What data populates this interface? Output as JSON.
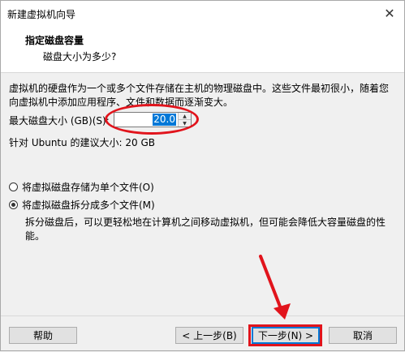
{
  "window": {
    "title": "新建虚拟机向导"
  },
  "header": {
    "title": "指定磁盘容量",
    "subtitle": "磁盘大小为多少?"
  },
  "main": {
    "description": "虚拟机的硬盘作为一个或多个文件存储在主机的物理磁盘中。这些文件最初很小，随着您向虚拟机中添加应用程序、文件和数据而逐渐变大。",
    "max_size_label": "最大磁盘大小 (GB)(S):",
    "max_size_value": "20.0",
    "recommend_text": "针对 Ubuntu 的建议大小: 20 GB",
    "options": [
      {
        "label": "将虚拟磁盘存储为单个文件(O)",
        "checked": false
      },
      {
        "label": "将虚拟磁盘拆分成多个文件(M)",
        "checked": true
      }
    ],
    "split_description": "拆分磁盘后，可以更轻松地在计算机之间移动虚拟机，但可能会降低大容量磁盘的性能。"
  },
  "footer": {
    "help_label": "帮助",
    "back_label": "< 上一步(B)",
    "next_label": "下一步(N) >",
    "cancel_label": "取消"
  },
  "icons": {
    "close": "close-icon",
    "spin_up": "chevron-up-icon",
    "spin_down": "chevron-down-icon"
  },
  "colors": {
    "annotation": "#e1141c",
    "accent": "#0078d7"
  }
}
